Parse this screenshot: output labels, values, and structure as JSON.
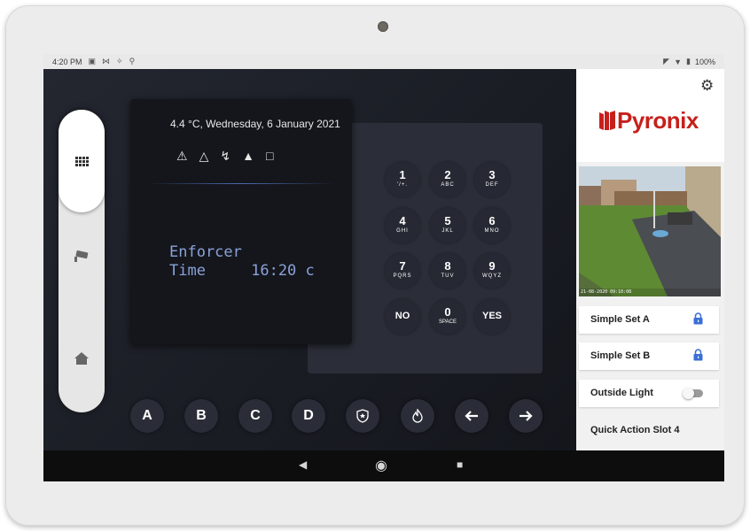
{
  "status_bar": {
    "time": "4:20 PM",
    "left_icons": [
      "image-icon",
      "mail-icon",
      "accessibility-icon",
      "location-icon"
    ],
    "right_icons": [
      "vibrate-icon",
      "wifi-icon",
      "battery-icon"
    ],
    "battery": "100%"
  },
  "side_nav": {
    "items": [
      {
        "name": "keypad",
        "active": true
      },
      {
        "name": "camera",
        "active": false
      },
      {
        "name": "home",
        "active": false
      }
    ]
  },
  "lcd": {
    "weather_line": "4.4 °C, Wednesday, 6 January 2021",
    "status_icons": [
      "warning-icon",
      "siren-icon",
      "tamper-icon",
      "fault-icon",
      "unlock-icon"
    ],
    "line1": "Enforcer",
    "line2": "Time     16:20 c"
  },
  "keypad": {
    "keys": [
      {
        "digit": "1",
        "letters": "'/+."
      },
      {
        "digit": "2",
        "letters": "ABC"
      },
      {
        "digit": "3",
        "letters": "DEF"
      },
      {
        "digit": "4",
        "letters": "GHI"
      },
      {
        "digit": "5",
        "letters": "JKL"
      },
      {
        "digit": "6",
        "letters": "MNO"
      },
      {
        "digit": "7",
        "letters": "PQRS"
      },
      {
        "digit": "8",
        "letters": "TUV"
      },
      {
        "digit": "9",
        "letters": "WQYZ"
      },
      {
        "digit": "NO",
        "letters": ""
      },
      {
        "digit": "0",
        "letters": "SPACE"
      },
      {
        "digit": "YES",
        "letters": ""
      }
    ]
  },
  "function_keys": {
    "a": "A",
    "b": "B",
    "c": "C",
    "d": "D",
    "icons": [
      "panic-shield-icon",
      "fire-icon",
      "arrow-left-icon",
      "arrow-right-icon"
    ]
  },
  "right_panel": {
    "brand": "Pyronix",
    "camera_timestamp": "21-08-2020 09:10:08",
    "quick_actions": [
      {
        "label": "Simple Set A",
        "control": "lock"
      },
      {
        "label": "Simple Set B",
        "control": "lock"
      },
      {
        "label": "Outside Light",
        "control": "toggle",
        "state": "off"
      },
      {
        "label": "Quick Action Slot 4",
        "control": "none"
      }
    ]
  },
  "colors": {
    "accent_blue": "#3b6fd6",
    "brand_red": "#c6201c",
    "lcd_text": "#8aa2d8"
  }
}
